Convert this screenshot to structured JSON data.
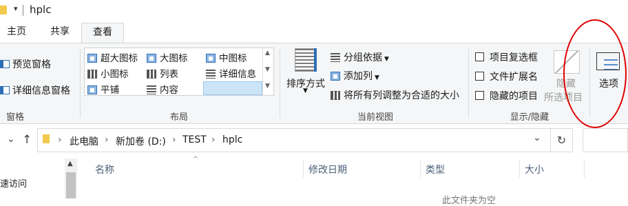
{
  "titlebar": {
    "title": "hplc",
    "quick_access_arrow": "▾"
  },
  "tabs": [
    {
      "label": "主页"
    },
    {
      "label": "共享"
    },
    {
      "label": "查看"
    }
  ],
  "ribbon": {
    "panes": {
      "preview_pane": "预览窗格",
      "details_pane": "详细信息窗格",
      "group_label": "窗格"
    },
    "layout": {
      "items": [
        {
          "label": "超大图标",
          "icon": "extra-large-icons-icon"
        },
        {
          "label": "大图标",
          "icon": "large-icons-icon"
        },
        {
          "label": "中图标",
          "icon": "medium-icons-icon"
        },
        {
          "label": "小图标",
          "icon": "small-icons-icon"
        },
        {
          "label": "列表",
          "icon": "list-icon"
        },
        {
          "label": "详细信息",
          "icon": "details-icon"
        },
        {
          "label": "平铺",
          "icon": "tiles-icon"
        },
        {
          "label": "内容",
          "icon": "content-icon"
        }
      ],
      "selected": "详细信息",
      "group_label": "布局"
    },
    "current_view": {
      "sort_by": "排序方式",
      "group_by": "分组依据",
      "add_columns": "添加列",
      "size_all_columns": "将所有列调整为合适的大小",
      "group_label": "当前视图"
    },
    "show_hide": {
      "item_checkboxes": "项目复选框",
      "file_name_extensions": "文件扩展名",
      "hidden_items": "隐藏的项目",
      "hide_selected_1": "隐藏",
      "hide_selected_2": "所选项目",
      "group_label": "显示/隐藏"
    },
    "options": {
      "label": "选项"
    }
  },
  "address_bar": {
    "crumbs": [
      "此电脑",
      "新加卷 (D:)",
      "TEST",
      "hplc"
    ],
    "up_arrow": "↑",
    "dropdown": "⌄",
    "refresh": "↻"
  },
  "columns": [
    "名称",
    "修改日期",
    "类型",
    "大小"
  ],
  "nav_pane": {
    "quick_access_partial": "速访问"
  },
  "empty_message_partial": "此文件夹为空",
  "colors": {
    "accent": "#2c6fb7",
    "highlight": "#cce4f7",
    "annotation_circle": "#e00000"
  }
}
